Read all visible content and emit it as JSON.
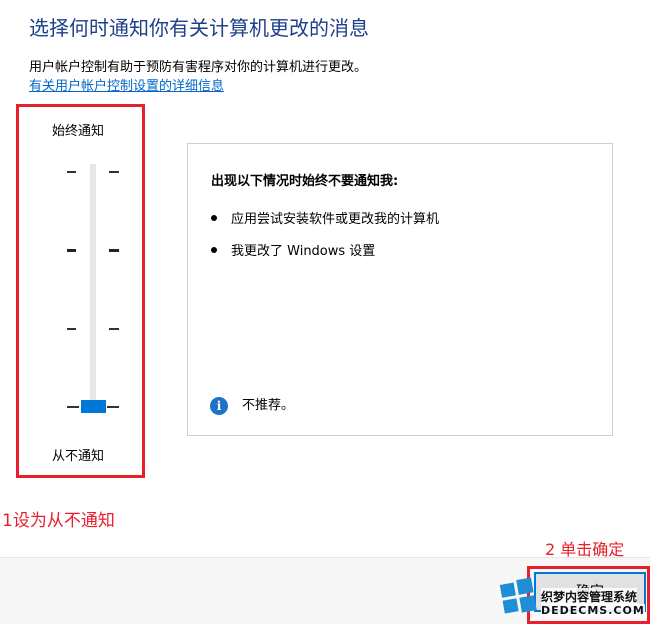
{
  "header": {
    "title": "选择何时通知你有关计算机更改的消息",
    "description": "用户帐户控制有助于预防有害程序对你的计算机进行更改。",
    "link_text": "有关用户帐户控制设置的详细信息"
  },
  "slider": {
    "top_label": "始终通知",
    "bottom_label": "从不通知",
    "level_count": 4,
    "selected_level": 1,
    "thumb_color": "#0078d7"
  },
  "panel": {
    "heading": "出现以下情况时始终不要通知我:",
    "items": [
      "应用尝试安装软件或更改我的计算机",
      "我更改了 Windows 设置"
    ],
    "note": "不推荐。",
    "note_icon": "info-icon"
  },
  "annotations": {
    "step1": "1设为从不通知",
    "step2": "2 单击确定",
    "highlight_color": "#e8202c"
  },
  "footer": {
    "ok_label": "确定"
  },
  "watermark": {
    "text_cn": "织梦内容管理系统",
    "text_en": "DEDECMS.COM",
    "logo_icon": "windows-logo-icon"
  }
}
